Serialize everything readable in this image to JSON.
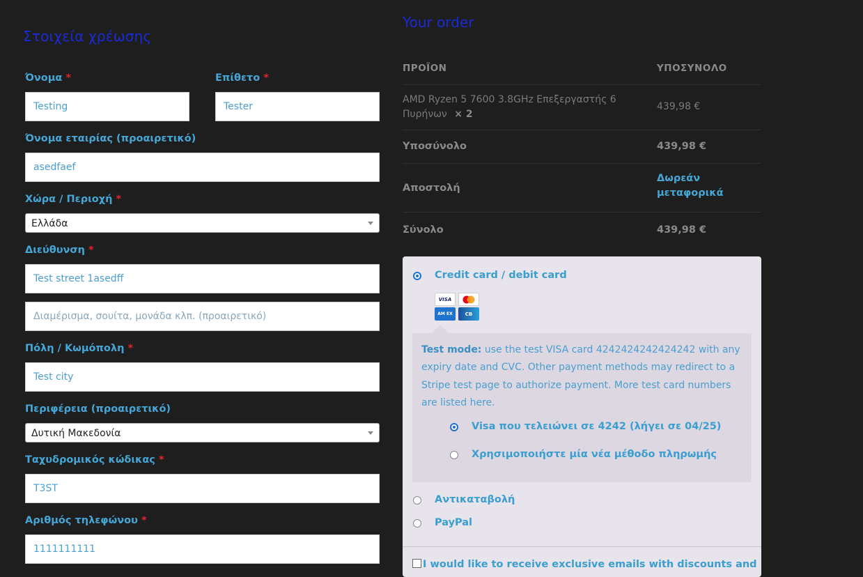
{
  "billing": {
    "title": "Στοιχεία χρέωσης",
    "required_mark": "*",
    "first_name": {
      "label": "Όνομα",
      "value": "Testing"
    },
    "last_name": {
      "label": "Επίθετο",
      "value": "Tester"
    },
    "company": {
      "label": "Όνομα εταιρίας (προαιρετικό)",
      "value": "asedfaef"
    },
    "country": {
      "label": "Χώρα / Περιοχή",
      "value": "Ελλάδα"
    },
    "address": {
      "label": "Διεύθυνση",
      "value": "Test street 1asedff",
      "line2_placeholder": "Διαμέρισμα, σουίτα, μονάδα κλπ. (προαιρετικό)"
    },
    "city": {
      "label": "Πόλη / Κωμόπολη",
      "value": "Test city"
    },
    "region": {
      "label": "Περιφέρεια (προαιρετικό)",
      "value": "Δυτική Μακεδονία"
    },
    "postcode": {
      "label": "Ταχυδρομικός κώδικας",
      "value": "T3ST"
    },
    "phone": {
      "label": "Αριθμός τηλεφώνου",
      "value": "1111111111"
    }
  },
  "order": {
    "title": "Your order",
    "col_product": "ΠΡΟΪΟΝ",
    "col_subtotal": "ΥΠΟΣΥΝΟΛΟ",
    "item": {
      "name_line1": "AMD Ryzen 5 7600 3.8GHz Επεξεργαστής 6",
      "name_line2": "Πυρήνων",
      "qty": "× 2",
      "price": "439,98 €"
    },
    "subtotal": {
      "label": "Υποσύνολο",
      "value": "439,98 €"
    },
    "shipping": {
      "label": "Αποστολή",
      "value_line1": "Δωρεάν",
      "value_line2": "μεταφορικά"
    },
    "total": {
      "label": "Σύνολο",
      "value": "439,98 €"
    }
  },
  "payment": {
    "card": {
      "label": "Credit card / debit card",
      "icons": [
        "visa-icon",
        "mastercard-icon",
        "amex-icon",
        "cartes-bancaires-icon"
      ],
      "visa_text": "VISA",
      "amex_text": "AM EX",
      "cb_text": "CB"
    },
    "test_mode": {
      "bold": "Test mode:",
      "lines": [
        " use the test VISA card 4242424242424242 with any",
        "expiry date and CVC. Other payment methods may redirect to a",
        "Stripe test page to authorize payment. More test card numbers",
        "are listed here."
      ]
    },
    "saved_card": "Visa που τελειώνει σε 4242 (λήγει σε 04/25)",
    "new_method": "Χρησιμοποιήστε μία νέα μέθοδο πληρωμής",
    "cod": "Αντικαταβολή",
    "paypal": "PayPal",
    "opt_in": "I would like to receive exclusive emails with discounts and"
  },
  "colors": {
    "background": "#1e1e1e",
    "title_blue": "#1a2bd6",
    "label_blue": "#45a6d6",
    "required_red": "#e0262c",
    "payment_box": "#e7e4ec"
  }
}
